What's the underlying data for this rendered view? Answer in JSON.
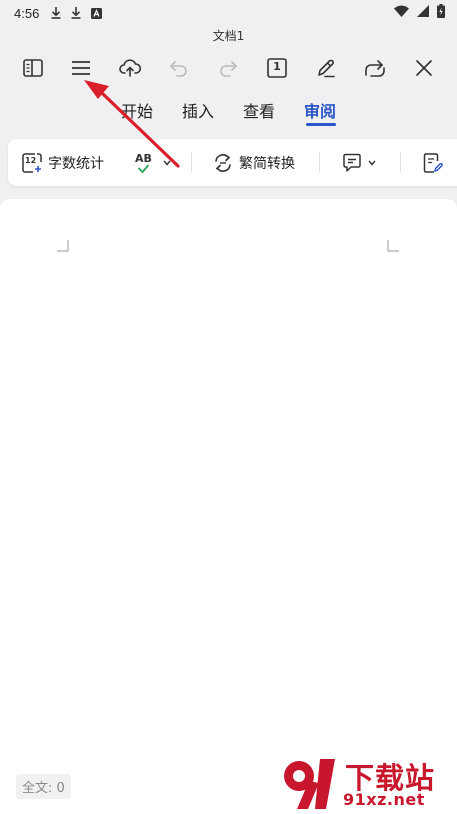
{
  "status_bar": {
    "time": "4:56",
    "left_icons": [
      "download-icon",
      "download-icon",
      "app-badge-icon"
    ],
    "right_icons": [
      "wifi-icon",
      "signal-icon",
      "battery-charging-icon"
    ]
  },
  "document": {
    "title": "文档1"
  },
  "toolbar": {
    "icons": [
      "sidebar-icon",
      "menu-icon",
      "cloud-upload-icon",
      "undo-icon",
      "redo-icon",
      "page-count-icon",
      "edit-pen-icon",
      "share-icon",
      "close-icon"
    ],
    "page_number": "1"
  },
  "tabs": [
    {
      "label": "开始",
      "active": false
    },
    {
      "label": "插入",
      "active": false
    },
    {
      "label": "查看",
      "active": false
    },
    {
      "label": "审阅",
      "active": true
    }
  ],
  "ribbon": {
    "word_count_label": "字数统计",
    "word_count_badge": "12",
    "spellcheck_badge": "AB",
    "convert_label": "繁简转换"
  },
  "footer": {
    "word_count_status": "全文: 0"
  },
  "watermark": {
    "logo_text": "9",
    "brand_top": "下载站",
    "brand_bottom": "91xz.net"
  },
  "colors": {
    "accent": "#2b55c8",
    "arrow": "#d9202a",
    "watermark": "#c8162d",
    "check_green": "#2aa55a"
  }
}
